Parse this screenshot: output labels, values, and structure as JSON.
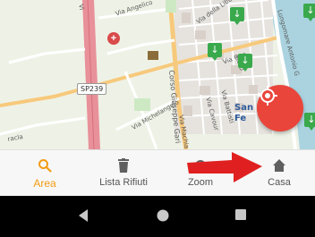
{
  "map": {
    "streets": {
      "angelico": "Via Angelico",
      "liberta": "Via della Libertà",
      "garibaldi": "Corso Giuseppe Gari",
      "genova": "Via Gen",
      "machiavelli": "Via Machia",
      "michelangelo": "Via Michelangelo",
      "battisti": "Via Battisti",
      "cavour": "Via Cavour",
      "lungomare": "Lungomare Antonio G",
      "racla": "racla",
      "via_o": "Via O",
      "vi": "Vi"
    },
    "road_shield": "SP239",
    "district": "San\nFe",
    "pins": [
      "recycling-bin",
      "recycling-bin",
      "recycling-bin",
      "recycling-bin",
      "recycling-bin"
    ]
  },
  "bottom_nav": {
    "items": [
      {
        "label": "Area",
        "icon": "search-icon",
        "active": true
      },
      {
        "label": "Lista Rifiuti",
        "icon": "trash-icon",
        "active": false
      },
      {
        "label": "Zoom",
        "icon": "zoom-icon",
        "active": false
      },
      {
        "label": "Casa",
        "icon": "home-icon",
        "active": false
      }
    ]
  },
  "colors": {
    "accent": "#f39c12",
    "locate_button": "#e9453a",
    "pin": "#3aa94c",
    "annotation_arrow": "#e02020"
  },
  "system_nav": {
    "buttons": [
      "back-icon",
      "home-circle-icon",
      "recents-icon"
    ]
  }
}
